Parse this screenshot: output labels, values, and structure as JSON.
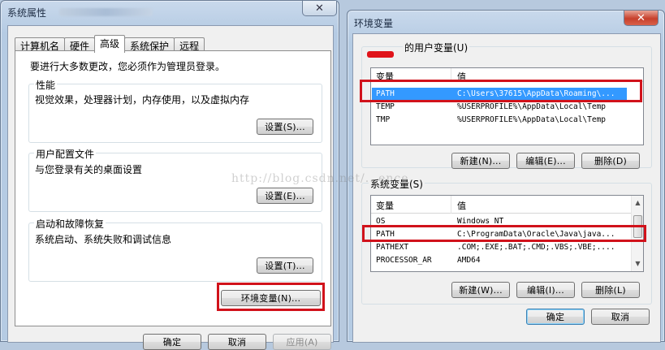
{
  "left_window": {
    "title": "系统属性",
    "tabs": [
      "计算机名",
      "硬件",
      "高级",
      "系统保护",
      "远程"
    ],
    "active_tab": "高级",
    "admin_note": "要进行大多数更改，您必须作为管理员登录。",
    "performance": {
      "label": "性能",
      "desc": "视觉效果，处理器计划，内存使用，以及虚拟内存",
      "button": "设置(S)..."
    },
    "user_profile": {
      "label": "用户配置文件",
      "desc": "与您登录有关的桌面设置",
      "button": "设置(E)..."
    },
    "startup": {
      "label": "启动和故障恢复",
      "desc": "系统启动、系统失败和调试信息",
      "button": "设置(T)..."
    },
    "env_button": "环境变量(N)...",
    "ok": "确定",
    "cancel": "取消",
    "apply": "应用(A)",
    "close_symbol": "✕"
  },
  "right_window": {
    "title": "环境变量",
    "close_symbol": "✕",
    "user_vars": {
      "label": "的用户变量(U)",
      "columns": [
        "变量",
        "值"
      ],
      "rows": [
        {
          "name": "PATH",
          "value": "C:\\Users\\37615\\AppData\\Roaming\\..."
        },
        {
          "name": "TEMP",
          "value": "%USERPROFILE%\\AppData\\Local\\Temp"
        },
        {
          "name": "TMP",
          "value": "%USERPROFILE%\\AppData\\Local\\Temp"
        }
      ],
      "selected_row": 0,
      "new_button": "新建(N)...",
      "edit_button": "编辑(E)...",
      "delete_button": "删除(D)"
    },
    "system_vars": {
      "label": "系统变量(S)",
      "columns": [
        "变量",
        "值"
      ],
      "rows": [
        {
          "name": "OS",
          "value": "Windows_NT"
        },
        {
          "name": "PATH",
          "value": "C:\\ProgramData\\Oracle\\Java\\java..."
        },
        {
          "name": "PATHEXT",
          "value": ".COM;.EXE;.BAT;.CMD;.VBS;.VBE;...."
        },
        {
          "name": "PROCESSOR_AR",
          "value": "AMD64"
        }
      ],
      "new_button": "新建(W)...",
      "edit_button": "编辑(I)...",
      "delete_button": "删除(L)"
    },
    "ok": "确定",
    "cancel": "取消"
  },
  "watermark": "http://blog.csdn.net/...ence",
  "colors": {
    "highlight": "#d1121b",
    "selection": "#3399ff",
    "close_red": "#c7402c"
  }
}
